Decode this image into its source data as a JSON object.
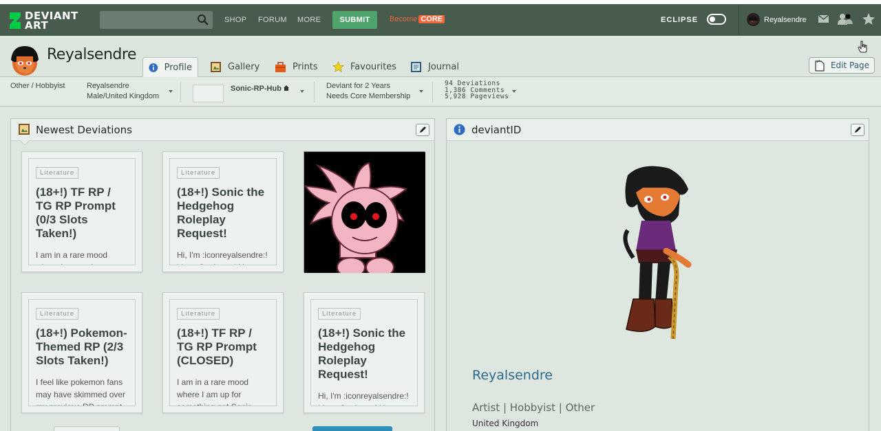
{
  "topbar": {
    "logo_line1": "DEVIANT",
    "logo_line2": "ART",
    "search_placeholder": "",
    "nav": [
      "SHOP",
      "FORUM",
      "MORE"
    ],
    "submit_label": "SUBMIT",
    "become_label": "Become",
    "core_label": "CORE",
    "eclipse_label": "ECLIPSE",
    "username": "Reyalsendre",
    "icons": [
      "mail-icon",
      "watch-icon",
      "star-icon"
    ]
  },
  "header": {
    "username": "Reyalsendre",
    "tabs": [
      {
        "label": "Profile",
        "icon": "info-icon",
        "active": true
      },
      {
        "label": "Gallery",
        "icon": "gallery-icon"
      },
      {
        "label": "Prints",
        "icon": "prints-icon"
      },
      {
        "label": "Favourites",
        "icon": "star-icon"
      },
      {
        "label": "Journal",
        "icon": "journal-icon"
      }
    ],
    "edit_page_label": "Edit Page"
  },
  "infobar": {
    "category": "Other / Hobbyist",
    "name": "Reyalsendre",
    "location": "Male/United Kingdom",
    "group": "Sonic-RP-Hub",
    "deviant_for": "Deviant for 2 Years",
    "membership": "Needs Core Membership",
    "deviations": "94 Deviations",
    "comments": "1,386 Comments",
    "pageviews": "5,928 Pageviews"
  },
  "newest": {
    "title": "Newest Deviations",
    "cards": [
      {
        "badge": "Literature",
        "title": "(18+!) TF RP / TG RP Prompt (0/3 Slots Taken!)",
        "desc": "I am in a rare mood where I am up for something not Sonic"
      },
      {
        "badge": "Literature",
        "title": "(18+!) Sonic the Hedgehog Roleplay Request!",
        "desc": "Hi, I'm :iconreyalsendre:! I love Sonic and I love"
      },
      {
        "image": "amy-rose-exe-image"
      },
      {
        "badge": "Literature",
        "title": "(18+!) Pokemon-Themed RP (2/3 Slots Taken!)",
        "desc": "I feel like pokemon fans may have skimmed over my previous RP prompt"
      },
      {
        "badge": "Literature",
        "title": "(18+!) TF RP / TG RP Prompt (CLOSED)",
        "desc": "I am in a rare mood where I am up for something not Sonic"
      },
      {
        "badge": "Literature",
        "title": "(18+!) Sonic the Hedgehog Roleplay Request!",
        "desc": "Hi, I'm :iconreyalsendre:! I love Sonic and I love"
      }
    ]
  },
  "deviantid": {
    "title": "deviantID",
    "name": "Reyalsendre",
    "roles": "Artist | Hobbyist | Other",
    "location": "United Kingdom"
  }
}
